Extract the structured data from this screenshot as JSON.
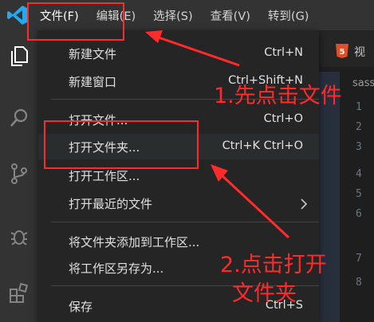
{
  "menubar": {
    "items": [
      {
        "label": "文件(F)"
      },
      {
        "label": "编辑(E)"
      },
      {
        "label": "选择(S)"
      },
      {
        "label": "查看(V)"
      },
      {
        "label": "转到(G)"
      }
    ]
  },
  "editor": {
    "tab_label": "视",
    "breadcrumb": "sass",
    "line_numbers": [
      "1",
      "2",
      "3",
      "4",
      "5",
      "6",
      "7",
      "8"
    ]
  },
  "file_menu": {
    "items": [
      {
        "label": "新建文件",
        "shortcut": "Ctrl+N"
      },
      {
        "label": "新建窗口",
        "shortcut": "Ctrl+Shift+N"
      },
      {
        "label": "打开文件...",
        "shortcut": "Ctrl+O"
      },
      {
        "label": "打开文件夹...",
        "shortcut": "Ctrl+K Ctrl+O"
      },
      {
        "label": "打开工作区...",
        "shortcut": ""
      },
      {
        "label": "打开最近的文件",
        "shortcut": ""
      },
      {
        "label": "将文件夹添加到工作区...",
        "shortcut": ""
      },
      {
        "label": "将工作区另存为...",
        "shortcut": ""
      },
      {
        "label": "保存",
        "shortcut": "Ctrl+S"
      }
    ]
  },
  "annotations": {
    "step1": "1.先点击文件",
    "step2_line1": "2.点击打开",
    "step2_line2": "文件夹",
    "color": "#ff2a2a"
  },
  "colors": {
    "menubar_bg": "#333333",
    "menu_bg": "#252526",
    "vscode_blue": "#23a9f2"
  }
}
